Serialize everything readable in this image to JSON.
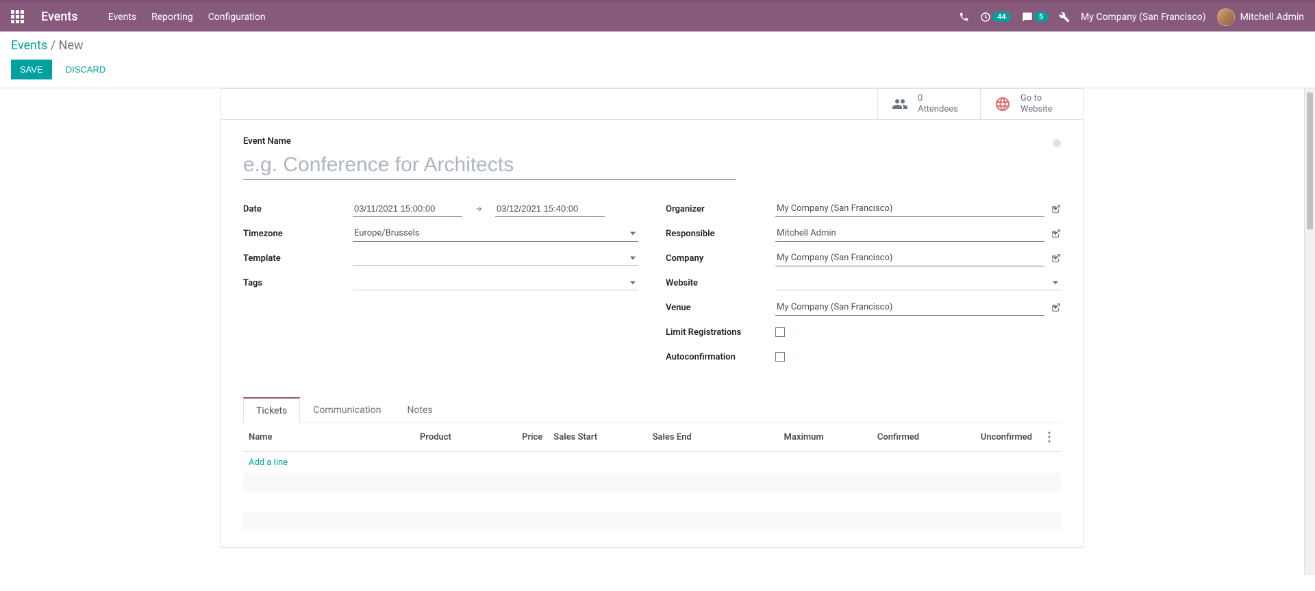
{
  "navbar": {
    "title": "Events",
    "menu": [
      "Events",
      "Reporting",
      "Configuration"
    ],
    "clock_badge": "44",
    "chat_badge": "5",
    "company": "My Company (San Francisco)",
    "user": "Mitchell Admin"
  },
  "breadcrumb": {
    "root": "Events",
    "current": "New"
  },
  "actions": {
    "save": "SAVE",
    "discard": "DISCARD"
  },
  "stat_buttons": {
    "attendees": {
      "value": "0",
      "label": "Attendees"
    },
    "website": {
      "line1": "Go to",
      "line2": "Website"
    }
  },
  "form": {
    "event_name_label": "Event Name",
    "event_name_placeholder": "e.g. Conference for Architects",
    "left": {
      "date_label": "Date",
      "date_start": "03/11/2021 15:00:00",
      "date_end": "03/12/2021 15:40:00",
      "timezone_label": "Timezone",
      "timezone_value": "Europe/Brussels",
      "template_label": "Template",
      "template_value": "",
      "tags_label": "Tags",
      "tags_value": ""
    },
    "right": {
      "organizer_label": "Organizer",
      "organizer_value": "My Company (San Francisco)",
      "responsible_label": "Responsible",
      "responsible_value": "Mitchell Admin",
      "company_label": "Company",
      "company_value": "My Company (San Francisco)",
      "website_label": "Website",
      "website_value": "",
      "venue_label": "Venue",
      "venue_value": "My Company (San Francisco)",
      "limit_label": "Limit Registrations",
      "autoconfirm_label": "Autoconfirmation"
    }
  },
  "tabs": {
    "items": [
      "Tickets",
      "Communication",
      "Notes"
    ],
    "table": {
      "headers": {
        "name": "Name",
        "product": "Product",
        "price": "Price",
        "sales_start": "Sales Start",
        "sales_end": "Sales End",
        "maximum": "Maximum",
        "confirmed": "Confirmed",
        "unconfirmed": "Unconfirmed"
      },
      "add_line": "Add a line"
    }
  }
}
